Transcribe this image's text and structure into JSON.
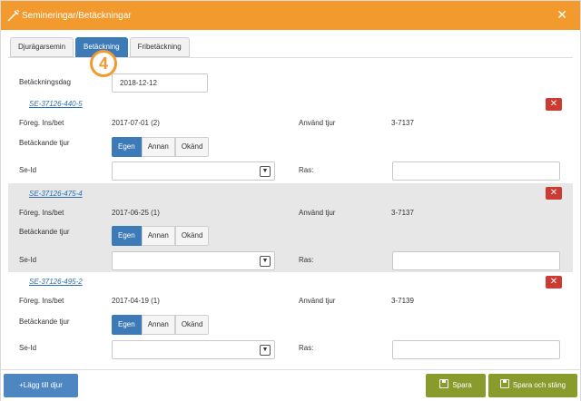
{
  "window": {
    "title": "Semineringar/Betäckningar",
    "close": "✕"
  },
  "tabs": [
    {
      "label": "Djurägarsemin"
    },
    {
      "label": "Betäckning"
    },
    {
      "label": "Fribetäckning"
    }
  ],
  "step_badge": "4",
  "form": {
    "date_label": "Betäckningsdag",
    "date_value": "2018-12-12"
  },
  "labels": {
    "prev": "Föreg. Ins/bet",
    "bull_used": "Använd tjur",
    "covering_bull": "Betäckande tjur",
    "se_id": "Se-Id",
    "breed": "Ras:"
  },
  "bull_options": [
    "Egen",
    "Annan",
    "Okänd"
  ],
  "animals": [
    {
      "id": "SE-37126-440-5",
      "prev_value": "2017-07-01 (2)",
      "bull_value": "3-7137",
      "selected": "Egen"
    },
    {
      "id": "SE-37126-475-4",
      "prev_value": "2017-06-25 (1)",
      "bull_value": "3-7137",
      "selected": "Egen"
    },
    {
      "id": "SE-37126-495-2",
      "prev_value": "2017-04-19 (1)",
      "bull_value": "3-7139",
      "selected": "Egen"
    }
  ],
  "footer": {
    "add_label": "+Lägg till djur",
    "save_label": "Spara",
    "save_close_label": "Spara och stäng"
  },
  "colors": {
    "titlebar": "#f29a2e",
    "primary": "#3d7ab8",
    "save": "#8a9b2e",
    "delete": "#cc3b33",
    "link": "#2a6fb0"
  }
}
